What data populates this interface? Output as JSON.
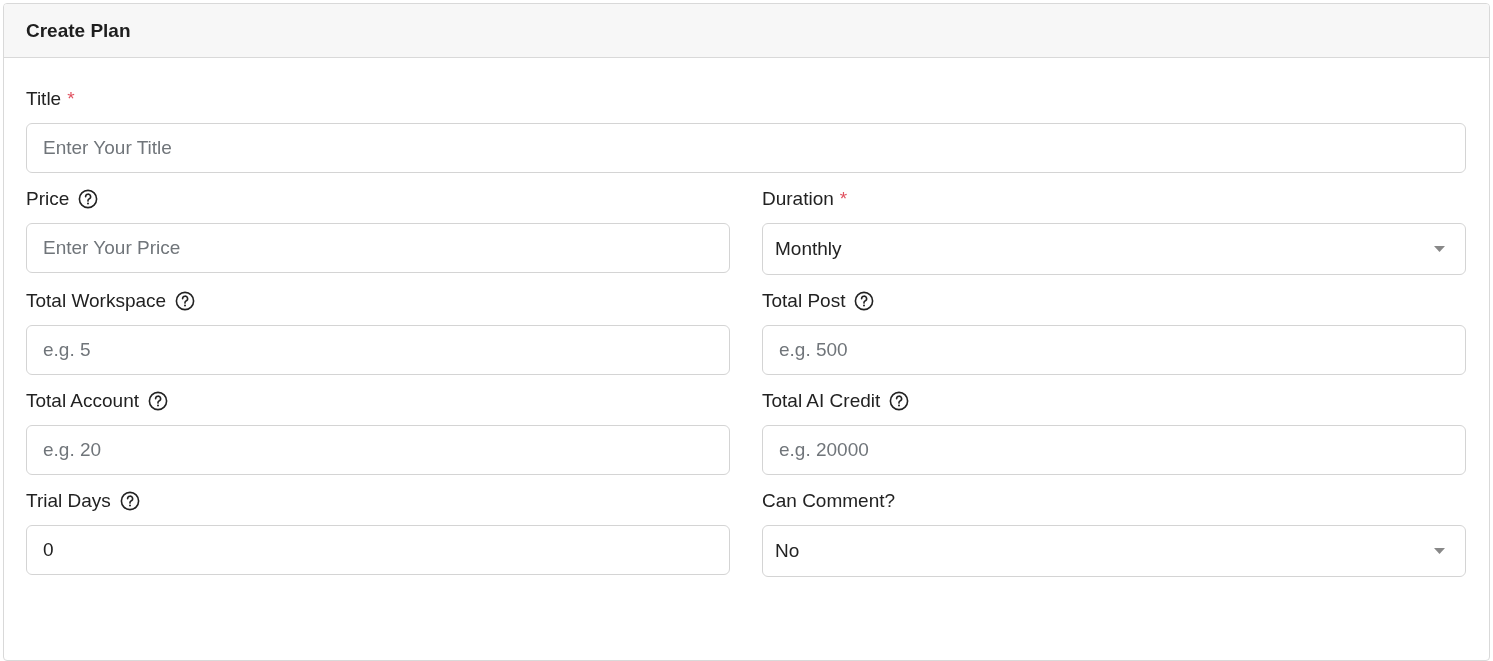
{
  "card": {
    "title": "Create Plan"
  },
  "title_field": {
    "label": "Title",
    "required_mark": "*",
    "help": false,
    "kind": "text",
    "placeholder": "Enter Your Title"
  },
  "fields": [
    {
      "label": "Price",
      "help": true,
      "kind": "text",
      "placeholder": "Enter Your Price"
    },
    {
      "label": "Duration",
      "required_mark": "*",
      "help": false,
      "kind": "select",
      "value": "Monthly"
    },
    {
      "label": "Total Workspace",
      "help": true,
      "kind": "text",
      "placeholder": "e.g. 5"
    },
    {
      "label": "Total Post",
      "help": true,
      "kind": "text",
      "placeholder": "e.g. 500"
    },
    {
      "label": "Total Account",
      "help": true,
      "kind": "text",
      "placeholder": "e.g. 20"
    },
    {
      "label": "Total AI Credit",
      "help": true,
      "kind": "text",
      "placeholder": "e.g. 20000"
    },
    {
      "label": "Trial Days",
      "help": true,
      "kind": "text",
      "value": "0"
    },
    {
      "label": "Can Comment?",
      "help": false,
      "kind": "select",
      "value": "No"
    }
  ]
}
